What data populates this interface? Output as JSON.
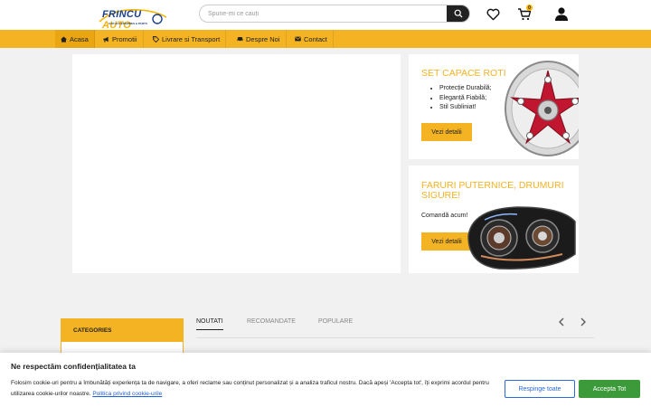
{
  "header": {
    "logo": {
      "part1": "FRINCU",
      "part2": "AUTO",
      "tagline": "CAR ACCESSORIES & PARTS"
    },
    "search": {
      "placeholder": "Spune-mi ce cauți"
    },
    "cart_count": "0",
    "icons": [
      "search-icon",
      "heart-icon",
      "cart-icon",
      "user-icon"
    ]
  },
  "nav": {
    "items": [
      {
        "label": "Acasa",
        "icon": "home-icon"
      },
      {
        "label": "Promotii",
        "icon": "megaphone-icon"
      },
      {
        "label": "Livrare si Transport",
        "icon": "tag-icon"
      },
      {
        "label": "Despre Noi",
        "icon": "car-icon"
      },
      {
        "label": "Contact",
        "icon": "envelope-icon"
      }
    ]
  },
  "promos": [
    {
      "title": "SET CAPACE ROTI",
      "bullets": [
        "Protecție Durabilă;",
        "Eleganță Fiabilă;",
        "Stil Subliniat!"
      ],
      "button": "Vezi detalii",
      "image": "hubcap"
    },
    {
      "title_line1": "FARURI PUTERNICE, DRUMURI",
      "title_line2": "SIGURE!",
      "text": "Comandă acum!",
      "button": "Vezi detalii",
      "image": "headlight"
    }
  ],
  "sidebar": {
    "categories_label": "CATEGORIES"
  },
  "tabs": [
    {
      "label": "NOUTATI",
      "active": true
    },
    {
      "label": "RECOMANDATE",
      "active": false
    },
    {
      "label": "POPULARE",
      "active": false
    }
  ],
  "cookie": {
    "title": "Ne respectăm confidențialitatea ta",
    "text": "Folosim cookie-uri pentru a îmbunătăți experiența ta de navigare, a oferi reclame sau conținut personalizat și a analiza traficul nostru. Dacă apeși 'Accepta tot', îți exprimi acordul pentru utilizarea cookie-urilor noastre.",
    "link": "Politica privind cookie-urile",
    "reject": "Respinge toate",
    "accept": "Accepta Tot"
  },
  "colors": {
    "accent": "#f4b323",
    "accept": "#3c9a3a",
    "reject": "#2a6bd9",
    "promo_title": "#f4b323"
  }
}
